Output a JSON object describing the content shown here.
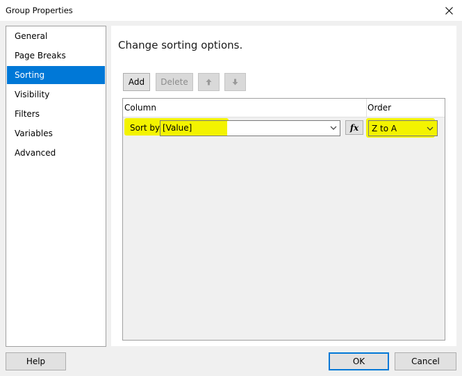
{
  "window": {
    "title": "Group Properties",
    "close_icon": "close-icon"
  },
  "nav": {
    "items": [
      {
        "label": "General",
        "selected": false
      },
      {
        "label": "Page Breaks",
        "selected": false
      },
      {
        "label": "Sorting",
        "selected": true
      },
      {
        "label": "Visibility",
        "selected": false
      },
      {
        "label": "Filters",
        "selected": false
      },
      {
        "label": "Variables",
        "selected": false
      },
      {
        "label": "Advanced",
        "selected": false
      }
    ]
  },
  "main": {
    "heading": "Change sorting options.",
    "toolbar": {
      "add_label": "Add",
      "delete_label": "Delete",
      "move_up_icon": "arrow-up-icon",
      "move_down_icon": "arrow-down-icon"
    },
    "grid": {
      "columns": [
        "Column",
        "Order"
      ],
      "rows": [
        {
          "row_label": "Sort by",
          "sort_value": "[Value]",
          "expression_button": "fx",
          "order": "Z to A"
        }
      ]
    }
  },
  "footer": {
    "help_label": "Help",
    "ok_label": "OK",
    "cancel_label": "Cancel"
  },
  "colors": {
    "selection": "#0078d7",
    "highlight": "#f3f300"
  }
}
